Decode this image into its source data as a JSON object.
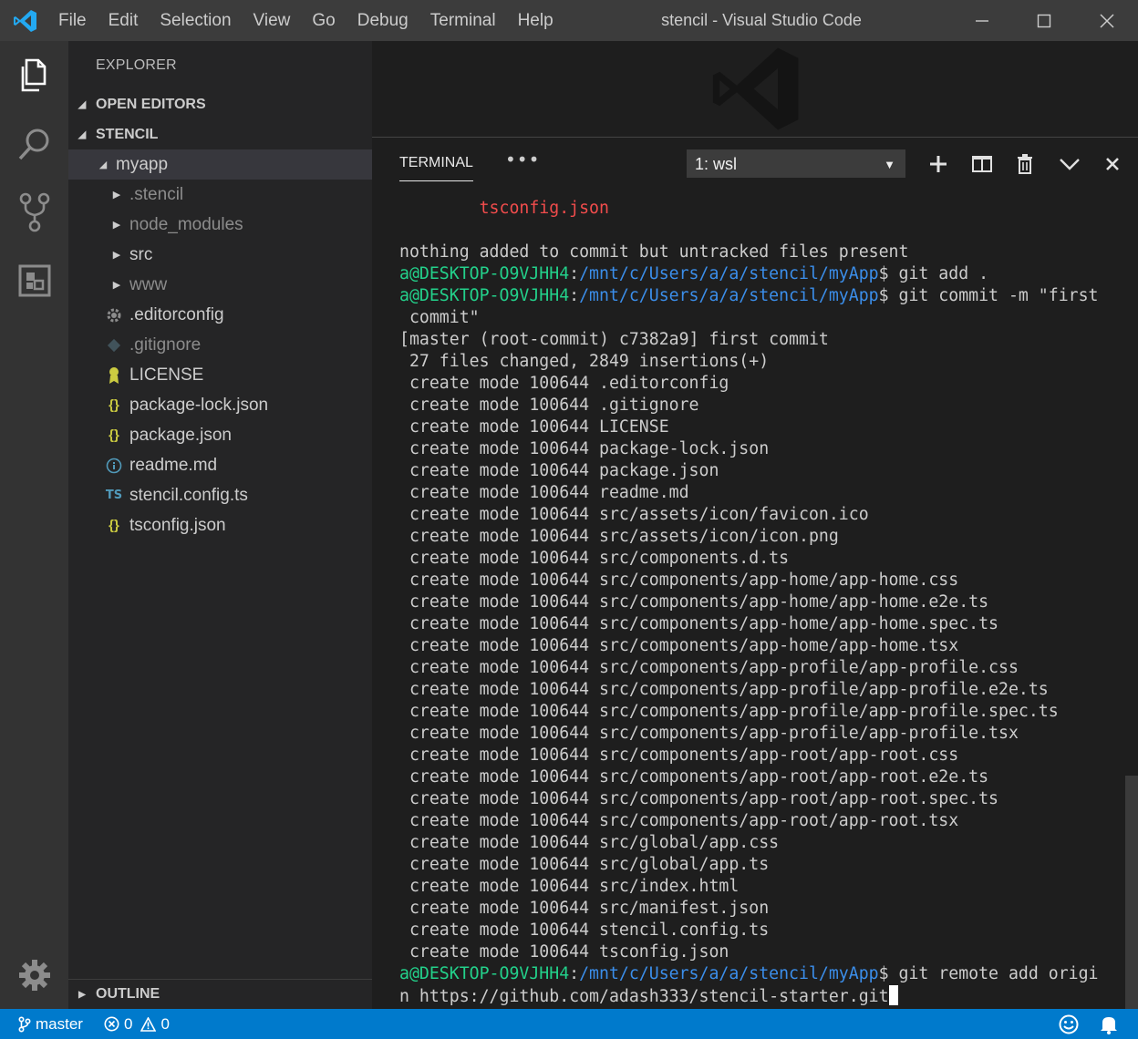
{
  "titlebar": {
    "menu": [
      "File",
      "Edit",
      "Selection",
      "View",
      "Go",
      "Debug",
      "Terminal",
      "Help"
    ],
    "title": "stencil - Visual Studio Code"
  },
  "sidebar": {
    "title": "EXPLORER",
    "open_editors": "OPEN EDITORS",
    "workspace": "STENCIL",
    "outline": "OUTLINE",
    "tree": [
      {
        "label": "myapp",
        "kind": "folder-open",
        "depth": 1
      },
      {
        "label": ".stencil",
        "kind": "folder",
        "depth": 2,
        "dim": true
      },
      {
        "label": "node_modules",
        "kind": "folder",
        "depth": 2,
        "dim": true
      },
      {
        "label": "src",
        "kind": "folder",
        "depth": 2
      },
      {
        "label": "www",
        "kind": "folder",
        "depth": 2,
        "dim": true
      },
      {
        "label": ".editorconfig",
        "kind": "gear-file",
        "depth": 2
      },
      {
        "label": ".gitignore",
        "kind": "git-file",
        "depth": 2,
        "dim": true
      },
      {
        "label": "LICENSE",
        "kind": "license-file",
        "depth": 2
      },
      {
        "label": "package-lock.json",
        "kind": "json-file",
        "depth": 2
      },
      {
        "label": "package.json",
        "kind": "json-file",
        "depth": 2
      },
      {
        "label": "readme.md",
        "kind": "info-file",
        "depth": 2
      },
      {
        "label": "stencil.config.ts",
        "kind": "ts-file",
        "depth": 2
      },
      {
        "label": "tsconfig.json",
        "kind": "json-file",
        "depth": 2
      }
    ],
    "json_glyph": "{}",
    "ts_glyph": "TS"
  },
  "panel": {
    "tab": "TERMINAL",
    "more": "•••",
    "terminal_select": "1: wsl"
  },
  "terminal": {
    "prompt_user": "a@DESKTOP-O9VJHH4",
    "prompt_path": "/mnt/c/Users/a/a/stencil/myApp",
    "lines": [
      {
        "type": "red",
        "text": "        tsconfig.json"
      },
      {
        "type": "plain",
        "text": ""
      },
      {
        "type": "plain",
        "text": "nothing added to commit but untracked files present"
      },
      {
        "type": "prompt",
        "text": " git add ."
      },
      {
        "type": "prompt",
        "text": " git commit -m \"first"
      },
      {
        "type": "plain",
        "text": " commit\""
      },
      {
        "type": "plain",
        "text": "[master (root-commit) c7382a9] first commit"
      },
      {
        "type": "plain",
        "text": " 27 files changed, 2849 insertions(+)"
      },
      {
        "type": "plain",
        "text": " create mode 100644 .editorconfig"
      },
      {
        "type": "plain",
        "text": " create mode 100644 .gitignore"
      },
      {
        "type": "plain",
        "text": " create mode 100644 LICENSE"
      },
      {
        "type": "plain",
        "text": " create mode 100644 package-lock.json"
      },
      {
        "type": "plain",
        "text": " create mode 100644 package.json"
      },
      {
        "type": "plain",
        "text": " create mode 100644 readme.md"
      },
      {
        "type": "plain",
        "text": " create mode 100644 src/assets/icon/favicon.ico"
      },
      {
        "type": "plain",
        "text": " create mode 100644 src/assets/icon/icon.png"
      },
      {
        "type": "plain",
        "text": " create mode 100644 src/components.d.ts"
      },
      {
        "type": "plain",
        "text": " create mode 100644 src/components/app-home/app-home.css"
      },
      {
        "type": "plain",
        "text": " create mode 100644 src/components/app-home/app-home.e2e.ts"
      },
      {
        "type": "plain",
        "text": " create mode 100644 src/components/app-home/app-home.spec.ts"
      },
      {
        "type": "plain",
        "text": " create mode 100644 src/components/app-home/app-home.tsx"
      },
      {
        "type": "plain",
        "text": " create mode 100644 src/components/app-profile/app-profile.css"
      },
      {
        "type": "plain",
        "text": " create mode 100644 src/components/app-profile/app-profile.e2e.ts"
      },
      {
        "type": "plain",
        "text": " create mode 100644 src/components/app-profile/app-profile.spec.ts"
      },
      {
        "type": "plain",
        "text": " create mode 100644 src/components/app-profile/app-profile.tsx"
      },
      {
        "type": "plain",
        "text": " create mode 100644 src/components/app-root/app-root.css"
      },
      {
        "type": "plain",
        "text": " create mode 100644 src/components/app-root/app-root.e2e.ts"
      },
      {
        "type": "plain",
        "text": " create mode 100644 src/components/app-root/app-root.spec.ts"
      },
      {
        "type": "plain",
        "text": " create mode 100644 src/components/app-root/app-root.tsx"
      },
      {
        "type": "plain",
        "text": " create mode 100644 src/global/app.css"
      },
      {
        "type": "plain",
        "text": " create mode 100644 src/global/app.ts"
      },
      {
        "type": "plain",
        "text": " create mode 100644 src/index.html"
      },
      {
        "type": "plain",
        "text": " create mode 100644 src/manifest.json"
      },
      {
        "type": "plain",
        "text": " create mode 100644 stencil.config.ts"
      },
      {
        "type": "plain",
        "text": " create mode 100644 tsconfig.json"
      },
      {
        "type": "prompt",
        "text": " git remote add origi"
      },
      {
        "type": "cursor",
        "text": "n https://github.com/adash333/stencil-starter.git"
      }
    ]
  },
  "statusbar": {
    "branch": "master",
    "errors": "0",
    "warnings": "0"
  },
  "colors": {
    "accent": "#007acc",
    "prompt_user": "#23d18b",
    "prompt_path": "#3b8eea",
    "untracked": "#f14c4c",
    "json_icon": "#cbcb41",
    "ts_icon": "#519aba",
    "license_icon": "#cbcb41"
  }
}
